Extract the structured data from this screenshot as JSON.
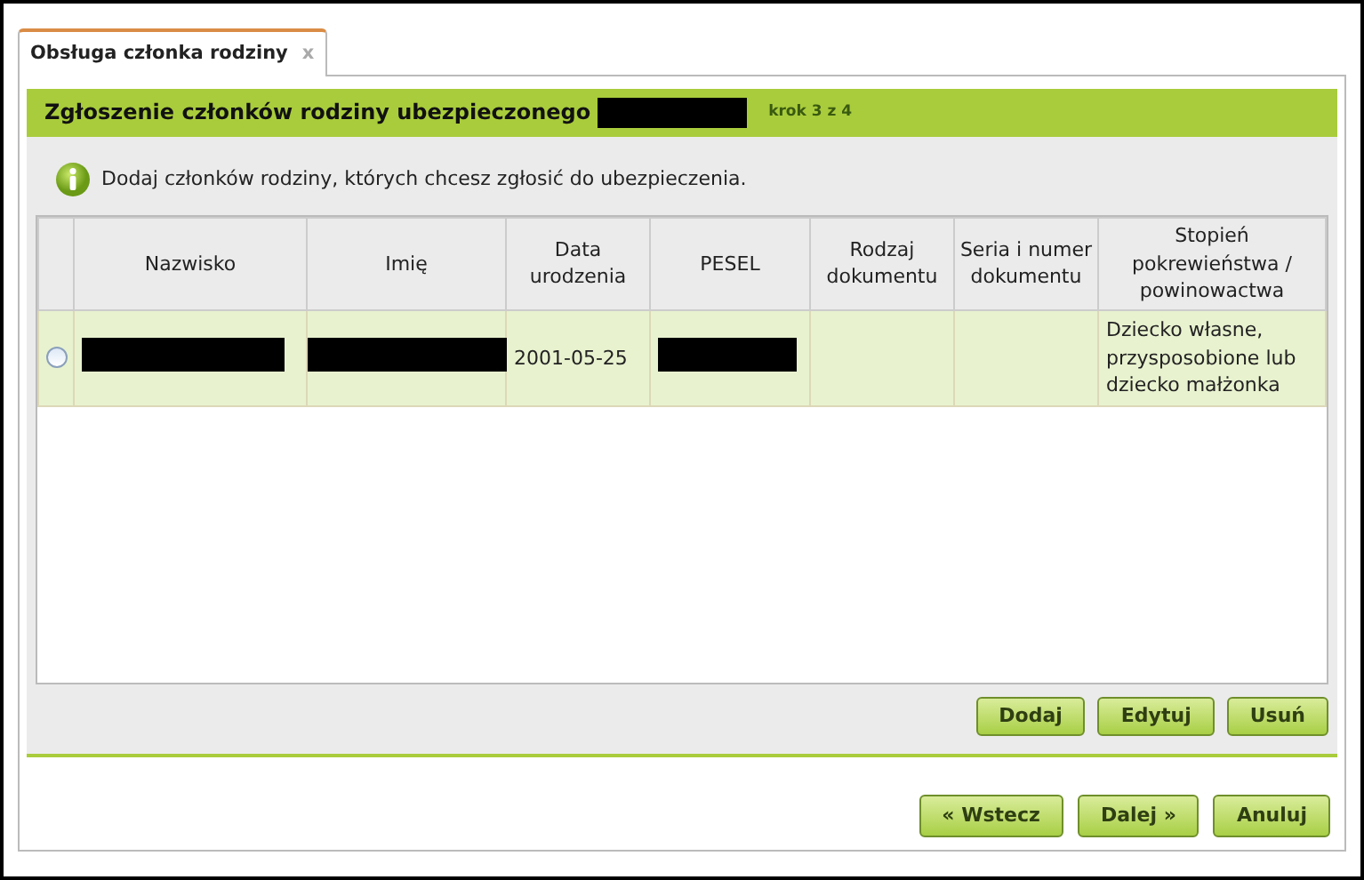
{
  "tabs": [
    {
      "label": "Obsługa członka rodziny",
      "selected": true,
      "close": "x"
    }
  ],
  "panel": {
    "title": "Zgłoszenie członków rodziny ubezpieczonego",
    "title_redacted": true,
    "step": "krok 3 z 4"
  },
  "info": "Dodaj członków rodziny, których chcesz zgłosić do ubezpieczenia.",
  "table": {
    "columns": [
      "Nazwisko",
      "Imię",
      "Data urodzenia",
      "PESEL",
      "Rodzaj dokumentu",
      "Seria i numer dokumentu",
      "Stopień pokrewieństwa / powinowactwa"
    ],
    "rows": [
      {
        "selected": false,
        "cells": [
          {
            "redacted": true
          },
          {
            "redacted": true
          },
          {
            "text": "2001-05-25"
          },
          {
            "redacted": true
          },
          {},
          {},
          {
            "text": "Dziecko własne, przysposobione lub dziecko małżonka"
          }
        ]
      }
    ]
  },
  "table_buttons": [
    "Dodaj",
    "Edytuj",
    "Usuń"
  ],
  "nav_buttons": [
    "« Wstecz",
    "Dalej »",
    "Anuluj"
  ]
}
